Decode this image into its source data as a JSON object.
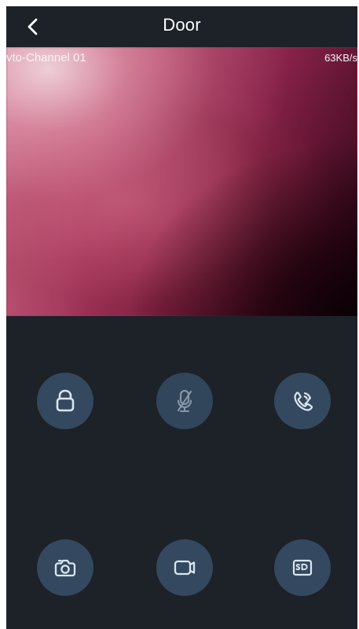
{
  "header": {
    "title": "Door"
  },
  "video": {
    "channel_label": "vto-Channel 01",
    "bitrate": "63KB/s"
  },
  "controls": {
    "unlock_icon": "lock-icon",
    "mute_icon": "microphone-off-icon",
    "hangup_icon": "phone-call-icon",
    "snapshot_icon": "camera-icon",
    "record_icon": "video-record-icon",
    "storage_icon": "sd-card-icon"
  },
  "colors": {
    "background": "#1d2128",
    "button": "#34495f",
    "icon": "#d9e6f2",
    "disabled_icon": "#8997a8"
  }
}
